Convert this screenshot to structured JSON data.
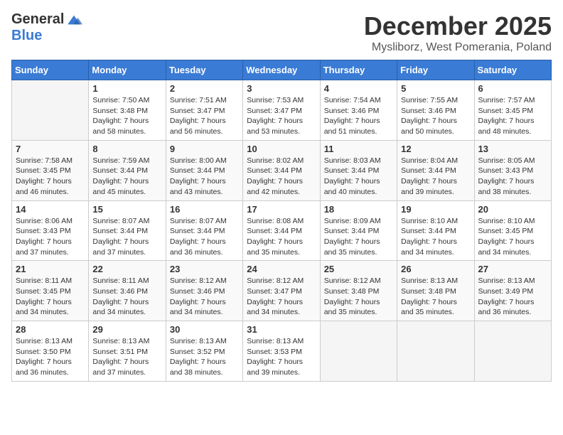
{
  "header": {
    "logo": {
      "general": "General",
      "blue": "Blue"
    },
    "title": "December 2025",
    "location": "Mysliborz, West Pomerania, Poland"
  },
  "days_of_week": [
    "Sunday",
    "Monday",
    "Tuesday",
    "Wednesday",
    "Thursday",
    "Friday",
    "Saturday"
  ],
  "weeks": [
    [
      {
        "num": "",
        "empty": true
      },
      {
        "num": "1",
        "sunrise": "Sunrise: 7:50 AM",
        "sunset": "Sunset: 3:48 PM",
        "daylight": "Daylight: 7 hours and 58 minutes."
      },
      {
        "num": "2",
        "sunrise": "Sunrise: 7:51 AM",
        "sunset": "Sunset: 3:47 PM",
        "daylight": "Daylight: 7 hours and 56 minutes."
      },
      {
        "num": "3",
        "sunrise": "Sunrise: 7:53 AM",
        "sunset": "Sunset: 3:47 PM",
        "daylight": "Daylight: 7 hours and 53 minutes."
      },
      {
        "num": "4",
        "sunrise": "Sunrise: 7:54 AM",
        "sunset": "Sunset: 3:46 PM",
        "daylight": "Daylight: 7 hours and 51 minutes."
      },
      {
        "num": "5",
        "sunrise": "Sunrise: 7:55 AM",
        "sunset": "Sunset: 3:46 PM",
        "daylight": "Daylight: 7 hours and 50 minutes."
      },
      {
        "num": "6",
        "sunrise": "Sunrise: 7:57 AM",
        "sunset": "Sunset: 3:45 PM",
        "daylight": "Daylight: 7 hours and 48 minutes."
      }
    ],
    [
      {
        "num": "7",
        "sunrise": "Sunrise: 7:58 AM",
        "sunset": "Sunset: 3:45 PM",
        "daylight": "Daylight: 7 hours and 46 minutes."
      },
      {
        "num": "8",
        "sunrise": "Sunrise: 7:59 AM",
        "sunset": "Sunset: 3:44 PM",
        "daylight": "Daylight: 7 hours and 45 minutes."
      },
      {
        "num": "9",
        "sunrise": "Sunrise: 8:00 AM",
        "sunset": "Sunset: 3:44 PM",
        "daylight": "Daylight: 7 hours and 43 minutes."
      },
      {
        "num": "10",
        "sunrise": "Sunrise: 8:02 AM",
        "sunset": "Sunset: 3:44 PM",
        "daylight": "Daylight: 7 hours and 42 minutes."
      },
      {
        "num": "11",
        "sunrise": "Sunrise: 8:03 AM",
        "sunset": "Sunset: 3:44 PM",
        "daylight": "Daylight: 7 hours and 40 minutes."
      },
      {
        "num": "12",
        "sunrise": "Sunrise: 8:04 AM",
        "sunset": "Sunset: 3:44 PM",
        "daylight": "Daylight: 7 hours and 39 minutes."
      },
      {
        "num": "13",
        "sunrise": "Sunrise: 8:05 AM",
        "sunset": "Sunset: 3:43 PM",
        "daylight": "Daylight: 7 hours and 38 minutes."
      }
    ],
    [
      {
        "num": "14",
        "sunrise": "Sunrise: 8:06 AM",
        "sunset": "Sunset: 3:43 PM",
        "daylight": "Daylight: 7 hours and 37 minutes."
      },
      {
        "num": "15",
        "sunrise": "Sunrise: 8:07 AM",
        "sunset": "Sunset: 3:44 PM",
        "daylight": "Daylight: 7 hours and 37 minutes."
      },
      {
        "num": "16",
        "sunrise": "Sunrise: 8:07 AM",
        "sunset": "Sunset: 3:44 PM",
        "daylight": "Daylight: 7 hours and 36 minutes."
      },
      {
        "num": "17",
        "sunrise": "Sunrise: 8:08 AM",
        "sunset": "Sunset: 3:44 PM",
        "daylight": "Daylight: 7 hours and 35 minutes."
      },
      {
        "num": "18",
        "sunrise": "Sunrise: 8:09 AM",
        "sunset": "Sunset: 3:44 PM",
        "daylight": "Daylight: 7 hours and 35 minutes."
      },
      {
        "num": "19",
        "sunrise": "Sunrise: 8:10 AM",
        "sunset": "Sunset: 3:44 PM",
        "daylight": "Daylight: 7 hours and 34 minutes."
      },
      {
        "num": "20",
        "sunrise": "Sunrise: 8:10 AM",
        "sunset": "Sunset: 3:45 PM",
        "daylight": "Daylight: 7 hours and 34 minutes."
      }
    ],
    [
      {
        "num": "21",
        "sunrise": "Sunrise: 8:11 AM",
        "sunset": "Sunset: 3:45 PM",
        "daylight": "Daylight: 7 hours and 34 minutes."
      },
      {
        "num": "22",
        "sunrise": "Sunrise: 8:11 AM",
        "sunset": "Sunset: 3:46 PM",
        "daylight": "Daylight: 7 hours and 34 minutes."
      },
      {
        "num": "23",
        "sunrise": "Sunrise: 8:12 AM",
        "sunset": "Sunset: 3:46 PM",
        "daylight": "Daylight: 7 hours and 34 minutes."
      },
      {
        "num": "24",
        "sunrise": "Sunrise: 8:12 AM",
        "sunset": "Sunset: 3:47 PM",
        "daylight": "Daylight: 7 hours and 34 minutes."
      },
      {
        "num": "25",
        "sunrise": "Sunrise: 8:12 AM",
        "sunset": "Sunset: 3:48 PM",
        "daylight": "Daylight: 7 hours and 35 minutes."
      },
      {
        "num": "26",
        "sunrise": "Sunrise: 8:13 AM",
        "sunset": "Sunset: 3:48 PM",
        "daylight": "Daylight: 7 hours and 35 minutes."
      },
      {
        "num": "27",
        "sunrise": "Sunrise: 8:13 AM",
        "sunset": "Sunset: 3:49 PM",
        "daylight": "Daylight: 7 hours and 36 minutes."
      }
    ],
    [
      {
        "num": "28",
        "sunrise": "Sunrise: 8:13 AM",
        "sunset": "Sunset: 3:50 PM",
        "daylight": "Daylight: 7 hours and 36 minutes."
      },
      {
        "num": "29",
        "sunrise": "Sunrise: 8:13 AM",
        "sunset": "Sunset: 3:51 PM",
        "daylight": "Daylight: 7 hours and 37 minutes."
      },
      {
        "num": "30",
        "sunrise": "Sunrise: 8:13 AM",
        "sunset": "Sunset: 3:52 PM",
        "daylight": "Daylight: 7 hours and 38 minutes."
      },
      {
        "num": "31",
        "sunrise": "Sunrise: 8:13 AM",
        "sunset": "Sunset: 3:53 PM",
        "daylight": "Daylight: 7 hours and 39 minutes."
      },
      {
        "num": "",
        "empty": true
      },
      {
        "num": "",
        "empty": true
      },
      {
        "num": "",
        "empty": true
      }
    ]
  ]
}
